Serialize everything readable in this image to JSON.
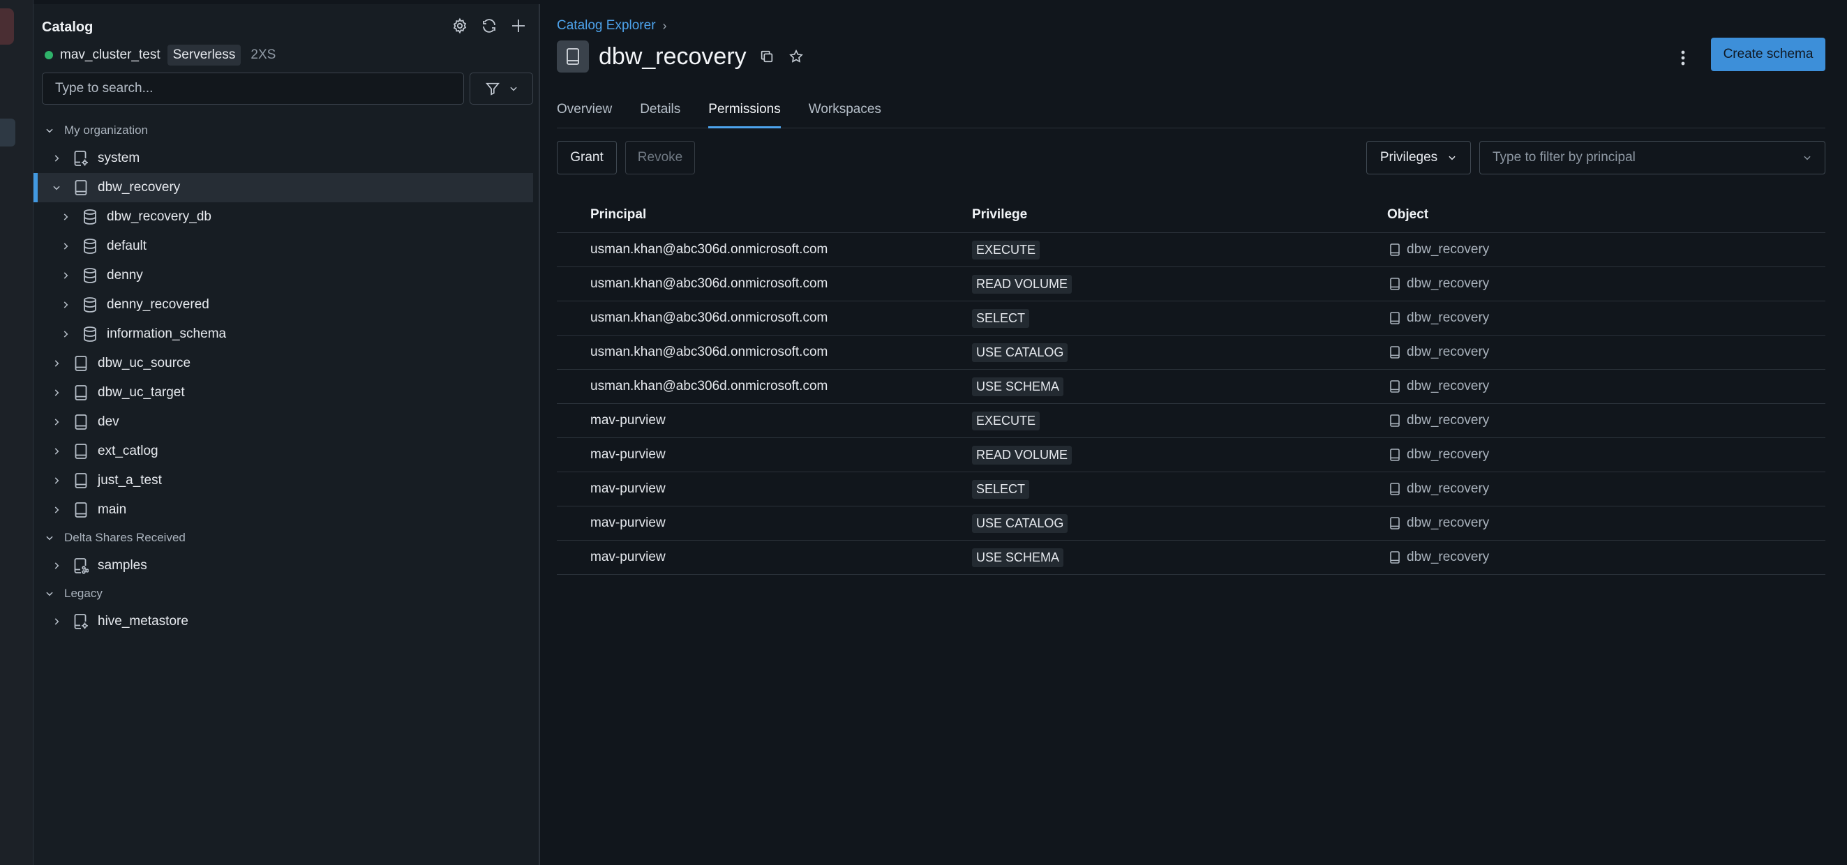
{
  "sidebar": {
    "title": "Catalog",
    "cluster": {
      "name": "mav_cluster_test",
      "type": "Serverless",
      "size": "2XS"
    },
    "search_placeholder": "Type to search...",
    "groups": [
      {
        "label": "My organization",
        "items": [
          {
            "label": "system",
            "icon": "catalog-gear-icon",
            "indent": 1
          },
          {
            "label": "dbw_recovery",
            "icon": "catalog-icon",
            "indent": 1,
            "expanded": true,
            "selected": true
          },
          {
            "label": "dbw_recovery_db",
            "icon": "database-icon",
            "indent": 2
          },
          {
            "label": "default",
            "icon": "database-icon",
            "indent": 2
          },
          {
            "label": "denny",
            "icon": "database-icon",
            "indent": 2
          },
          {
            "label": "denny_recovered",
            "icon": "database-icon",
            "indent": 2
          },
          {
            "label": "information_schema",
            "icon": "database-icon",
            "indent": 2
          },
          {
            "label": "dbw_uc_source",
            "icon": "catalog-icon",
            "indent": 1
          },
          {
            "label": "dbw_uc_target",
            "icon": "catalog-icon",
            "indent": 1
          },
          {
            "label": "dev",
            "icon": "catalog-icon",
            "indent": 1
          },
          {
            "label": "ext_catlog",
            "icon": "catalog-icon",
            "indent": 1
          },
          {
            "label": "just_a_test",
            "icon": "catalog-icon",
            "indent": 1
          },
          {
            "label": "main",
            "icon": "catalog-icon",
            "indent": 1
          }
        ]
      },
      {
        "label": "Delta Shares Received",
        "items": [
          {
            "label": "samples",
            "icon": "catalog-share-icon",
            "indent": 1
          }
        ]
      },
      {
        "label": "Legacy",
        "items": [
          {
            "label": "hive_metastore",
            "icon": "catalog-gear-icon",
            "indent": 1
          }
        ]
      }
    ]
  },
  "main": {
    "breadcrumb": "Catalog Explorer",
    "breadcrumb_separator": "›",
    "title": "dbw_recovery",
    "create_button": "Create schema",
    "tabs": [
      "Overview",
      "Details",
      "Permissions",
      "Workspaces"
    ],
    "active_tab": "Permissions",
    "grant_label": "Grant",
    "revoke_label": "Revoke",
    "privileges_label": "Privileges",
    "principal_filter_placeholder": "Type to filter by principal",
    "columns": [
      "Principal",
      "Privilege",
      "Object"
    ],
    "rows": [
      {
        "principal": "usman.khan@abc306d.onmicrosoft.com",
        "privilege": "EXECUTE",
        "object": "dbw_recovery"
      },
      {
        "principal": "usman.khan@abc306d.onmicrosoft.com",
        "privilege": "READ VOLUME",
        "object": "dbw_recovery"
      },
      {
        "principal": "usman.khan@abc306d.onmicrosoft.com",
        "privilege": "SELECT",
        "object": "dbw_recovery"
      },
      {
        "principal": "usman.khan@abc306d.onmicrosoft.com",
        "privilege": "USE CATALOG",
        "object": "dbw_recovery"
      },
      {
        "principal": "usman.khan@abc306d.onmicrosoft.com",
        "privilege": "USE SCHEMA",
        "object": "dbw_recovery"
      },
      {
        "principal": "mav-purview",
        "privilege": "EXECUTE",
        "object": "dbw_recovery"
      },
      {
        "principal": "mav-purview",
        "privilege": "READ VOLUME",
        "object": "dbw_recovery"
      },
      {
        "principal": "mav-purview",
        "privilege": "SELECT",
        "object": "dbw_recovery"
      },
      {
        "principal": "mav-purview",
        "privilege": "USE CATALOG",
        "object": "dbw_recovery"
      },
      {
        "principal": "mav-purview",
        "privilege": "USE SCHEMA",
        "object": "dbw_recovery"
      }
    ]
  },
  "colors": {
    "accent": "#4da3ec",
    "primary_button": "#3d8fd9",
    "status_online": "#2fb36a",
    "background": "#11161c",
    "sidebar": "#171d23"
  }
}
